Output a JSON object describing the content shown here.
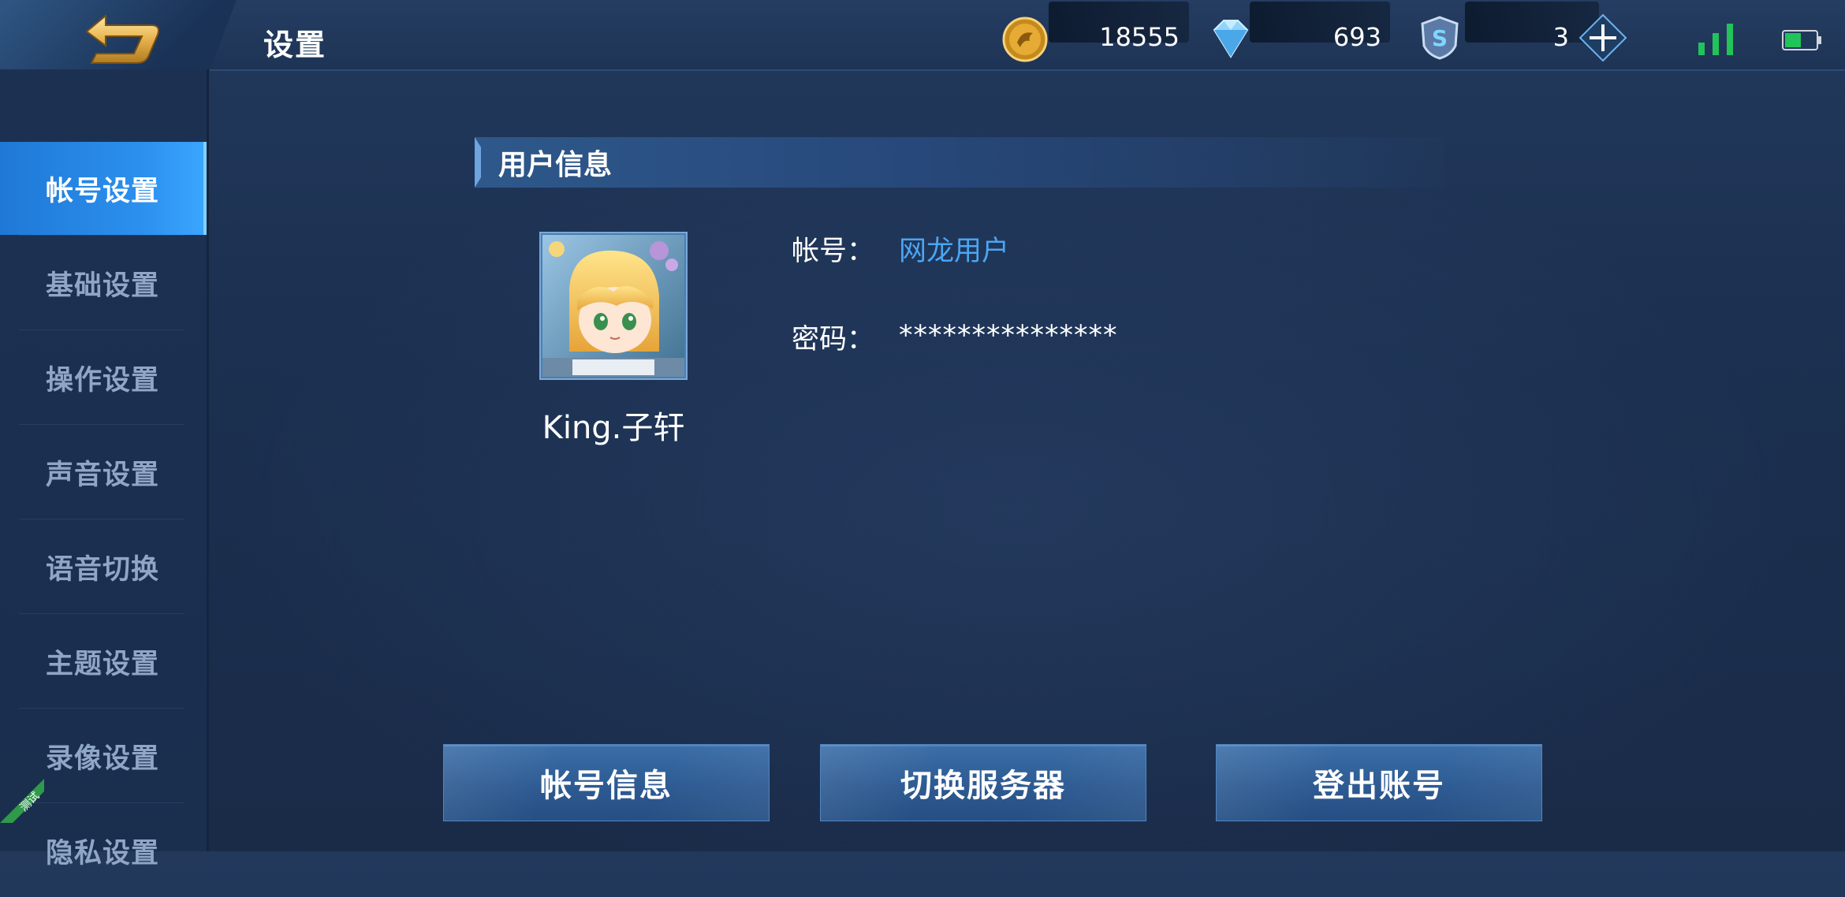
{
  "header": {
    "title": "设置",
    "back_icon": "back-arrow-icon",
    "gold": "18555",
    "diamond": "693",
    "tickets": "3",
    "status": {
      "signal_icon": "signal-icon",
      "battery_icon": "battery-icon",
      "battery_color": "#22c35a"
    }
  },
  "sidebar": {
    "items": [
      {
        "label": "帐号设置",
        "active": true
      },
      {
        "label": "基础设置",
        "active": false
      },
      {
        "label": "操作设置",
        "active": false
      },
      {
        "label": "声音设置",
        "active": false
      },
      {
        "label": "语音切换",
        "active": false
      },
      {
        "label": "主题设置",
        "active": false
      },
      {
        "label": "录像设置",
        "active": false
      },
      {
        "label": "隐私设置",
        "active": false
      }
    ],
    "beta_badge": "测试"
  },
  "user_info": {
    "section_title": "用户信息",
    "username": "King.子轩",
    "account_label": "帐号：",
    "account_value": "网龙用户",
    "password_label": "密码：",
    "password_value": "***************"
  },
  "buttons": {
    "account_info": "帐号信息",
    "switch_server": "切换服务器",
    "logout": "登出账号"
  },
  "colors": {
    "accent_blue": "#4aa6f3",
    "active_tab": "#2c90ee"
  }
}
